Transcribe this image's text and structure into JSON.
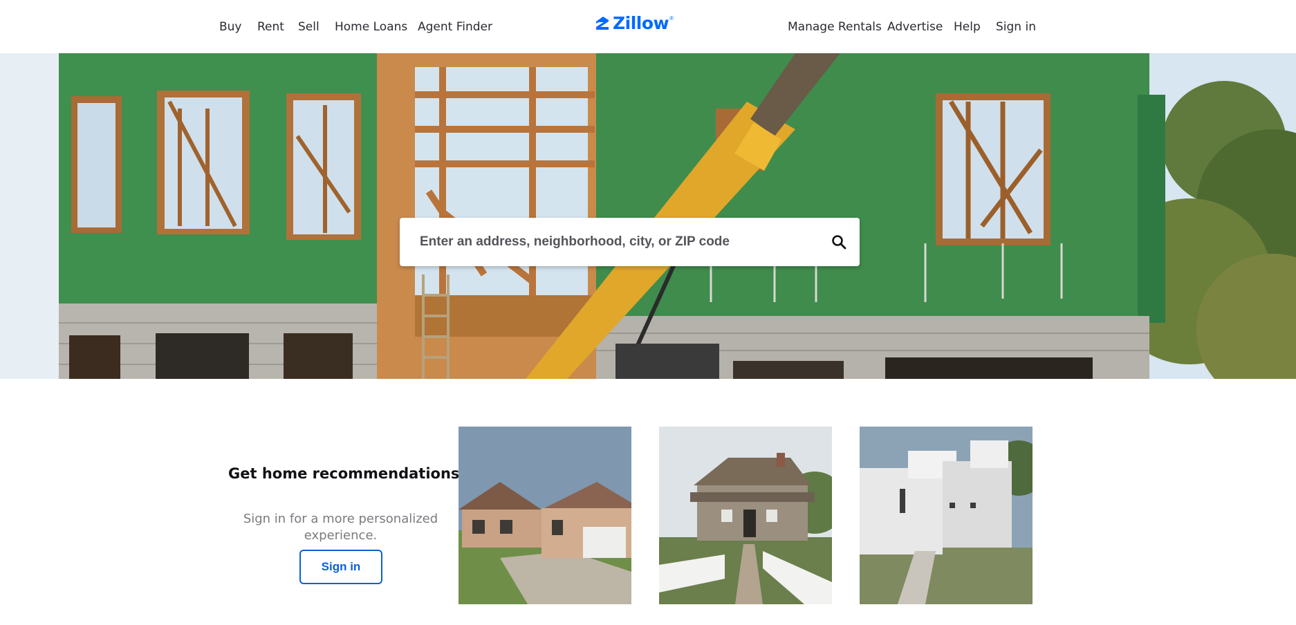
{
  "header": {
    "nav_left": [
      "Buy",
      "Rent",
      "Sell",
      "Home Loans",
      "Agent Finder"
    ],
    "logo_text": "Zillow",
    "logo_mark": "®",
    "nav_right": [
      "Manage Rentals",
      "Advertise",
      "Help",
      "Sign in"
    ]
  },
  "hero": {
    "image": "house-under-construction",
    "search": {
      "placeholder": "Enter an address, neighborhood, city, or ZIP code",
      "value": "",
      "icon": "search-icon"
    }
  },
  "recommendations": {
    "title": "Get home recommendations",
    "subtitle": "Sign in for a more personalized experience.",
    "button_label": "Sign in",
    "cards": [
      {
        "image": "suburban-house-with-garage"
      },
      {
        "image": "wooden-cabin-with-picket-fence"
      },
      {
        "image": "white-modern-house"
      }
    ]
  },
  "colors": {
    "brand": "#006aff",
    "button_border": "#0d5fd6",
    "text": "#2a2a33",
    "muted": "#7a7a80"
  }
}
